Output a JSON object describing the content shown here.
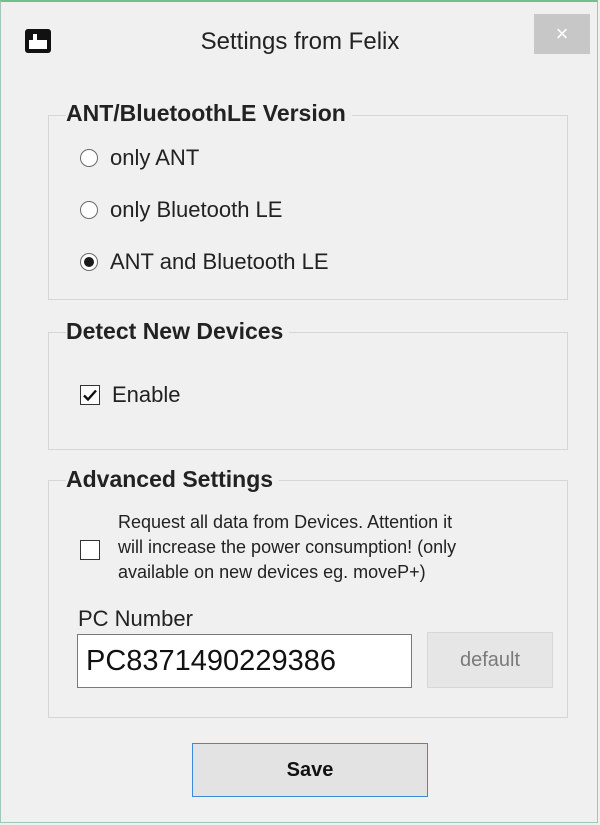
{
  "window": {
    "title": "Settings from Felix",
    "close_label": "×",
    "app_icon": "app-icon"
  },
  "ant_group": {
    "title": "ANT/BluetoothLE Version",
    "options": [
      {
        "label": "only ANT",
        "selected": false
      },
      {
        "label": "only Bluetooth LE",
        "selected": false
      },
      {
        "label": "ANT and Bluetooth LE",
        "selected": true
      }
    ]
  },
  "detect_group": {
    "title": "Detect New Devices",
    "enable_label": "Enable",
    "enable_checked": true
  },
  "advanced_group": {
    "title": "Advanced Settings",
    "request_checked": false,
    "request_lines": [
      "Request all data from Devices. Attention it",
      "will increase the power consumption! (only",
      "available on new devices eg. moveP+)"
    ],
    "pc_number_label": "PC Number",
    "pc_number_value": "PC8371490229386",
    "default_button_label": "default"
  },
  "footer": {
    "save_label": "Save"
  }
}
